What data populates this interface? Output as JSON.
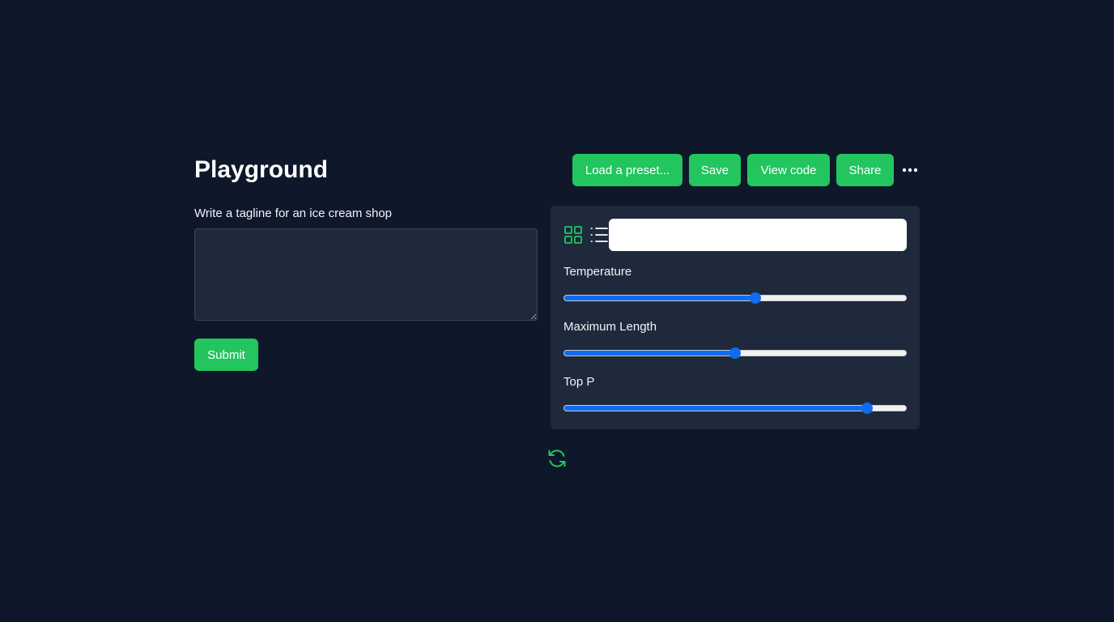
{
  "header": {
    "title": "Playground"
  },
  "toolbar": {
    "load_preset_label": "Load a preset...",
    "save_label": "Save",
    "view_code_label": "View code",
    "share_label": "Share",
    "more_icon": "more-horizontal-icon"
  },
  "prompt": {
    "label": "Write a tagline for an ice cream shop",
    "value": "",
    "submit_label": "Submit"
  },
  "settings": {
    "view_icons": [
      "grid-icon",
      "list-icon"
    ],
    "input_value": "",
    "sliders": [
      {
        "key": "temperature",
        "label": "Temperature",
        "value": 0.56
      },
      {
        "key": "maximum_length",
        "label": "Maximum Length",
        "value": 0.5
      },
      {
        "key": "top_p",
        "label": "Top P",
        "value": 0.885
      }
    ]
  },
  "refresh_icon": "refresh-icon",
  "colors": {
    "background": "#0f172a",
    "panel": "#1e293b",
    "accent": "#22c55e",
    "slider_fill": "#0f6cf0"
  }
}
